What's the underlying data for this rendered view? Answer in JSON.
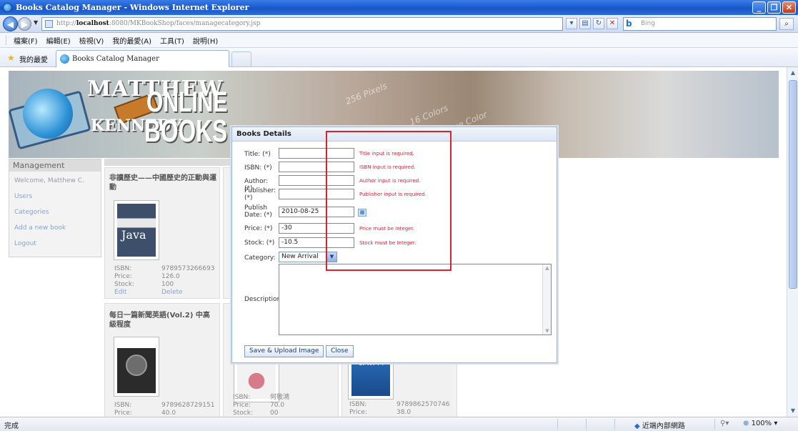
{
  "window": {
    "title": "Books Catalog Manager - Windows Internet Explorer",
    "controls": [
      "_",
      "❐",
      "✕"
    ]
  },
  "address": {
    "url_prefix": "http://",
    "url_host": "localhost",
    "url_rest": ":8080/MKBookShop/faces/managecategory.jsp",
    "search_placeholder": "Bing"
  },
  "menubar": [
    "檔案(F)",
    "編輯(E)",
    "檢視(V)",
    "我的最愛(A)",
    "工具(T)",
    "說明(H)"
  ],
  "favorites": {
    "label": "我的最愛",
    "tab_title": "Books Catalog Manager"
  },
  "banner": {
    "line1": "MATTHEW",
    "online": "ONLINE",
    "kennedy": "KENNEDY",
    "books": "BOOKS"
  },
  "sidebar": {
    "title": "Management",
    "welcome": "Welcome, Matthew C.",
    "items": [
      {
        "label": "Users"
      },
      {
        "label": "Categories"
      },
      {
        "label": "Add a new book"
      },
      {
        "label": "Logout"
      }
    ]
  },
  "books": [
    {
      "title": "非讀歷史——中國歷史的正動與運動",
      "cover_colors": [
        "#3d4f6a",
        "#e8e8e8",
        "#c48a2e"
      ],
      "isbn_label": "ISBN:",
      "isbn": "9789573266693",
      "price_label": "Price:",
      "price": "126.0",
      "stock_label": "Stock:",
      "stock": "100",
      "edit": "Edit",
      "delete": "Delete"
    },
    {
      "title": "每日一篇新聞英語(Vol.2) 中高級程度",
      "cover_colors": [
        "#ffffff",
        "#2b2b2b",
        "#e89b34"
      ],
      "isbn_label": "ISBN:",
      "isbn": "9789628729151",
      "price_label": "Price:",
      "price": "40.0"
    },
    {
      "title": "",
      "isbn_label": "ISBN:",
      "isbn": "何敬鴻",
      "price_label": "Price:",
      "price": "70.0",
      "stock_label": "Stock:",
      "stock": "00"
    },
    {
      "title": "",
      "isbn_label": "ISBN:",
      "isbn": "9789862570746",
      "price_label": "Price:",
      "price": "38.0"
    }
  ],
  "dialog": {
    "title": "Books Details",
    "fields": [
      {
        "label": "Title: (*)",
        "value": "",
        "error": "Title input is required."
      },
      {
        "label": "ISBN: (*)",
        "value": "",
        "error": "ISBN input is required."
      },
      {
        "label": "Author: (*)",
        "value": "",
        "error": "Author input is required."
      },
      {
        "label": "Publisher: (*)",
        "value": "",
        "error": "Publisher input is required."
      },
      {
        "label": "Publish Date: (*)",
        "value": "2010-08-25",
        "error": ""
      },
      {
        "label": "Price: (*)",
        "value": "-30",
        "error": "Price must be Integer."
      },
      {
        "label": "Stock: (*)",
        "value": "-10.5",
        "error": "Stock must be Integer."
      }
    ],
    "category_label": "Category:",
    "category_value": "New Arrival",
    "description_label": "Description:",
    "save_button": "Save & Upload Image",
    "close_button": "Close",
    "highlight_color": "#d8232a"
  },
  "status": {
    "left": "完成",
    "zone": "近端內部網路",
    "zoom": "100%"
  }
}
